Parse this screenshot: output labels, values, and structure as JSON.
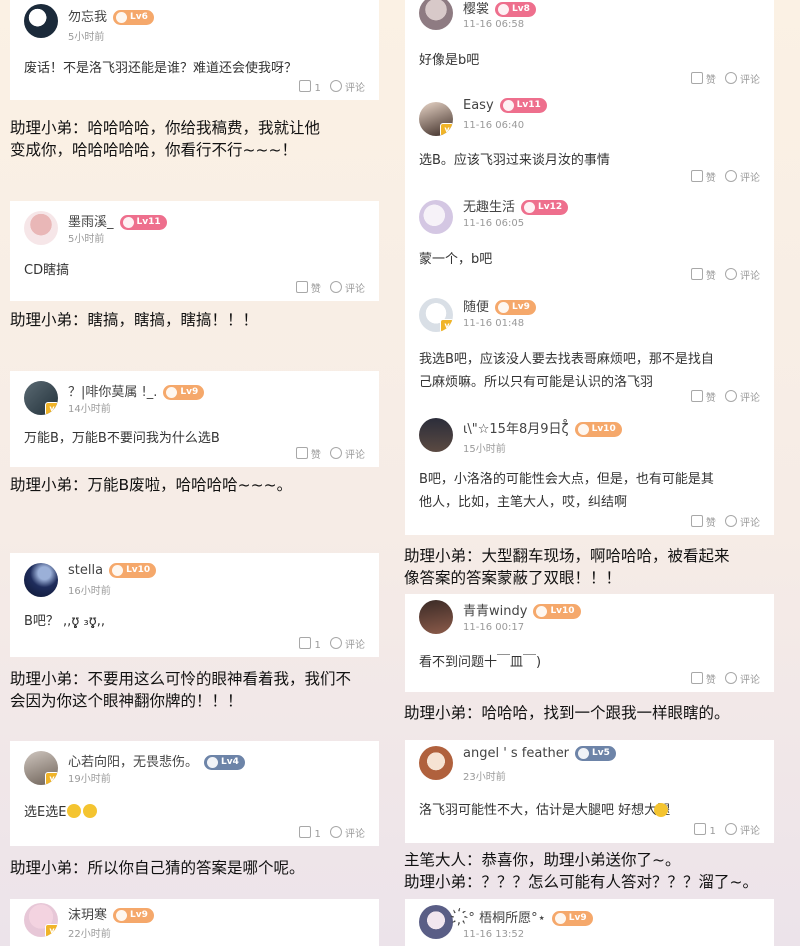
{
  "labels": {
    "like": "赞",
    "comment": "评论"
  },
  "left": {
    "cards": [
      {
        "user": "勿忘我",
        "level": "Lv6",
        "time": "5小时前",
        "text": "废话！不是洛飞羽还能是谁？难道还会使我呀？",
        "likes": "1",
        "level_color": "orange"
      },
      {
        "user": "墨雨溪_",
        "level": "Lv11",
        "time": "5小时前",
        "text": "CD瞎搞",
        "likes": "",
        "level_color": "pink"
      },
      {
        "user": "？|啡你莫属 !_.",
        "level": "Lv9",
        "time": "14小时前",
        "text": "万能B，万能B不要问我为什么选B",
        "likes": "",
        "level_color": "orange"
      },
      {
        "user": "stella",
        "level": "Lv10",
        "time": "16小时前",
        "text": "B吧？ ,,ʊ̥̥̥̥̥̥̥̥̥̥̥̥̥ ₃ʊ̥̥̥̥̥̥̥̥̥̥̥̥̥,,",
        "likes": "1",
        "level_color": "orange"
      },
      {
        "user": "心若向阳，无畏悲伤。",
        "level": "Lv4",
        "time": "19小时前",
        "text": "选E选E",
        "likes": "1",
        "level_color": "blue"
      },
      {
        "user": "沫玥寒",
        "level": "Lv9",
        "time": "22小时前",
        "text": "",
        "likes": "",
        "level_color": "orange"
      }
    ],
    "replies": [
      {
        "lines": [
          "助理小弟：哈哈哈哈，你给我稿费，我就让他",
          "变成你，哈哈哈哈哈，你看行不行~~~！"
        ]
      },
      {
        "lines": [
          "助理小弟：瞎搞，瞎搞，瞎搞！！！"
        ]
      },
      {
        "lines": [
          "助理小弟：万能B废啦，哈哈哈哈~~~。"
        ]
      },
      {
        "lines": [
          "助理小弟：不要用这么可怜的眼神看着我，我们不",
          "会因为你这个眼神翻你牌的！！！"
        ]
      },
      {
        "lines": [
          "助理小弟：所以你自己猜的答案是哪个呢。"
        ]
      }
    ]
  },
  "right": {
    "cards": [
      {
        "user": "樱裳",
        "level": "Lv8",
        "time": "11-16 06:58",
        "text": [
          "好像是b吧"
        ],
        "likes": "",
        "level_color": "pink"
      },
      {
        "user": "Easy",
        "level": "Lv11",
        "time": "11-16 06:40",
        "text": [
          "选B。应该飞羽过来谈月汝的事情"
        ],
        "likes": "",
        "level_color": "pink"
      },
      {
        "user": "无趣生活",
        "level": "Lv12",
        "time": "11-16 06:05",
        "text": [
          "蒙一个，b吧"
        ],
        "likes": "",
        "level_color": "pink"
      },
      {
        "user": "随便",
        "level": "Lv9",
        "time": "11-16 01:48",
        "text": [
          "我选B吧，应该没人要去找表哥麻烦吧，那不是找自",
          "己麻烦嘛。所以只有可能是认识的洛飞羽"
        ],
        "likes": "",
        "level_color": "orange"
      },
      {
        "user": "ι\\\"☆15年8月9日ζ̊",
        "level": "Lv10",
        "time": "15小时前",
        "text": [
          "B吧，小洛洛的可能性会大点，但是，也有可能是其",
          "他人，比如，主笔大人，哎，纠结啊"
        ],
        "likes": "",
        "level_color": "orange"
      },
      {
        "user": "青青windy",
        "level": "Lv10",
        "time": "11-16 00:17",
        "text": [
          "看不到问题十￣皿￣)"
        ],
        "likes": "",
        "level_color": "orange"
      },
      {
        "user": "angel ' s feather",
        "level": "Lv5",
        "time": "23小时前",
        "text": [
          "洛飞羽可能性不大，估计是大腿吧 好想大腿"
        ],
        "likes": "1",
        "level_color": "blue"
      },
      {
        "user": "҉° 梧桐所愿°⋆",
        "level": "Lv9",
        "time": "11-16 13:52",
        "text": [
          ""
        ],
        "likes": "",
        "level_color": "orange"
      }
    ],
    "replies": [
      {
        "lines": [
          "助理小弟：大型翻车现场，啊哈哈哈，被看起来",
          "像答案的答案蒙蔽了双眼！！！"
        ]
      },
      {
        "lines": [
          "助理小弟：哈哈哈，找到一个跟我一样眼瞎的。"
        ]
      },
      {
        "lines": [
          "主笔大人：恭喜你，助理小弟送你了~。",
          "助理小弟：？？？怎么可能有人答对？？？溜了~。"
        ]
      }
    ]
  }
}
